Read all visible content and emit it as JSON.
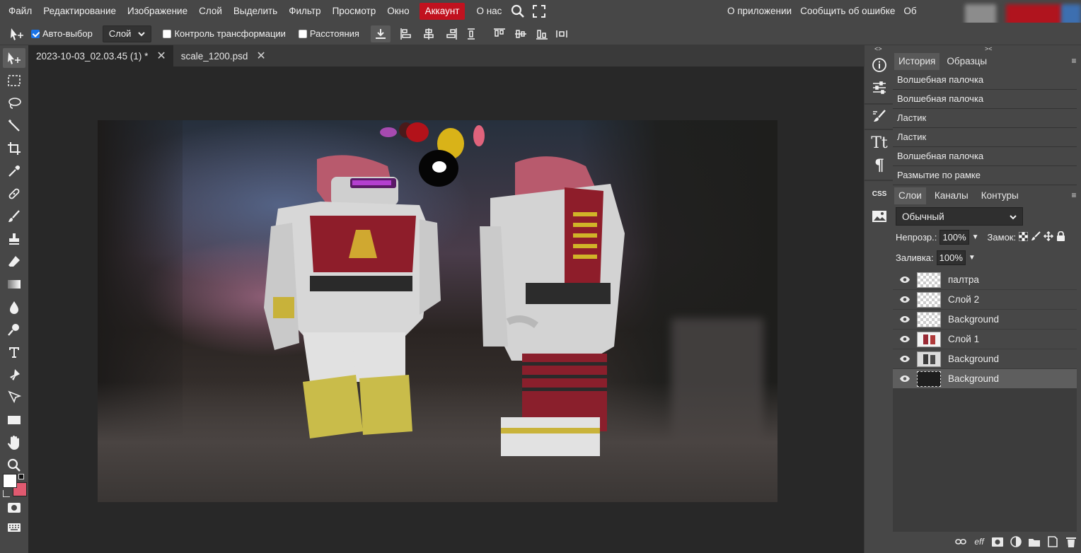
{
  "menu": {
    "items": [
      "Файл",
      "Редактирование",
      "Изображение",
      "Слой",
      "Выделить",
      "Фильтр",
      "Просмотр",
      "Окно"
    ],
    "account": "Аккаунт",
    "about": "О нас",
    "right_items": [
      "О приложении",
      "Сообщить об ошибке",
      "Об"
    ]
  },
  "options": {
    "auto_select_label": "Авто-выбор",
    "auto_select_checked": true,
    "select_target": "Слой",
    "transform_label": "Контроль трансформации",
    "distances_label": "Расстояния"
  },
  "tabs": [
    {
      "label": "2023-10-03_02.03.45 (1) *",
      "active": true
    },
    {
      "label": "scale_1200.psd",
      "active": false
    }
  ],
  "panels": {
    "history_tabs": [
      "История",
      "Образцы"
    ],
    "history": [
      "Волшебная палочка",
      "Волшебная палочка",
      "Ластик",
      "Ластик",
      "Волшебная палочка",
      "Размытие по рамке"
    ],
    "layer_tabs": [
      "Слои",
      "Каналы",
      "Контуры"
    ],
    "blend_mode": "Обычный",
    "opacity_label": "Непрозр.:",
    "opacity_value": "100%",
    "lock_label": "Замок:",
    "fill_label": "Заливка:",
    "fill_value": "100%",
    "layers": [
      {
        "name": "палтра",
        "thumb": "transparent",
        "active": false
      },
      {
        "name": "Слой 2",
        "thumb": "transparent",
        "active": false
      },
      {
        "name": "Background",
        "thumb": "transparent",
        "active": false
      },
      {
        "name": "Слой 1",
        "thumb": "armor",
        "active": false
      },
      {
        "name": "Background",
        "thumb": "armor-dark",
        "active": false
      },
      {
        "name": "Background",
        "thumb": "dark",
        "active": true
      }
    ],
    "footer_eff": "eff"
  },
  "side_strip_labels": {
    "css": "CSS",
    "text": "Tt",
    "para": "¶"
  },
  "colors": {
    "bar": "#474747",
    "workspace": "#282828",
    "account_red": "#c1121f",
    "fg_color": "#ffffff",
    "bg_color": "#e05a70"
  }
}
